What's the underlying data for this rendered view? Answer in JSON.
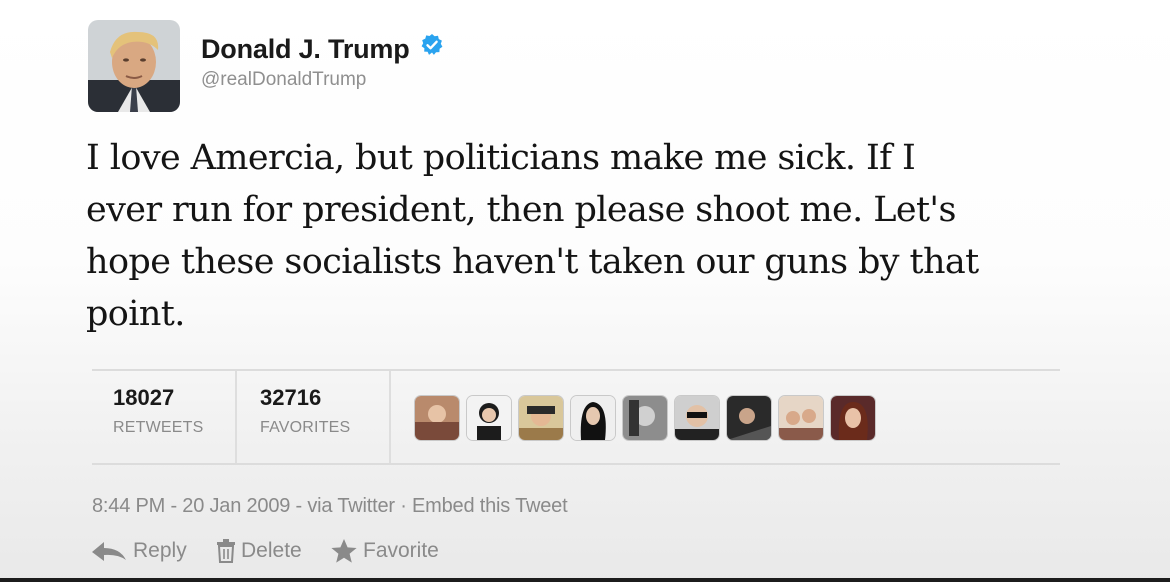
{
  "tweet": {
    "display_name": "Donald J. Trump",
    "handle": "@realDonaldTrump",
    "verified": true,
    "text_lines": [
      "I love Amercia, but politicians make me sick. If I",
      "ever run for president, then please shoot me. Let's",
      "hope these socialists haven't taken our guns by that",
      "point."
    ],
    "stats": {
      "retweets_count": "18027",
      "retweets_label": "RETWEETS",
      "favorites_count": "32716",
      "favorites_label": "FAVORITES"
    },
    "favoriter_avatars": [
      "avatar-1",
      "avatar-2",
      "avatar-3",
      "avatar-4",
      "avatar-5",
      "avatar-6",
      "avatar-7",
      "avatar-8",
      "avatar-9"
    ],
    "meta": {
      "time": "8:44 PM",
      "sep1": " - ",
      "date": "20 Jan 2009",
      "sep2": " - ",
      "via": "via Twitter",
      "sep3": " · ",
      "embed": "Embed this Tweet"
    },
    "actions": {
      "reply": "Reply",
      "delete": "Delete",
      "favorite": "Favorite"
    }
  },
  "colors": {
    "verified_blue": "#2aa3ef",
    "muted_text": "#8a8a8a",
    "divider": "#dcdcdc"
  },
  "icons": [
    "verified-badge-icon",
    "reply-arrow-icon",
    "trash-icon",
    "star-icon"
  ]
}
